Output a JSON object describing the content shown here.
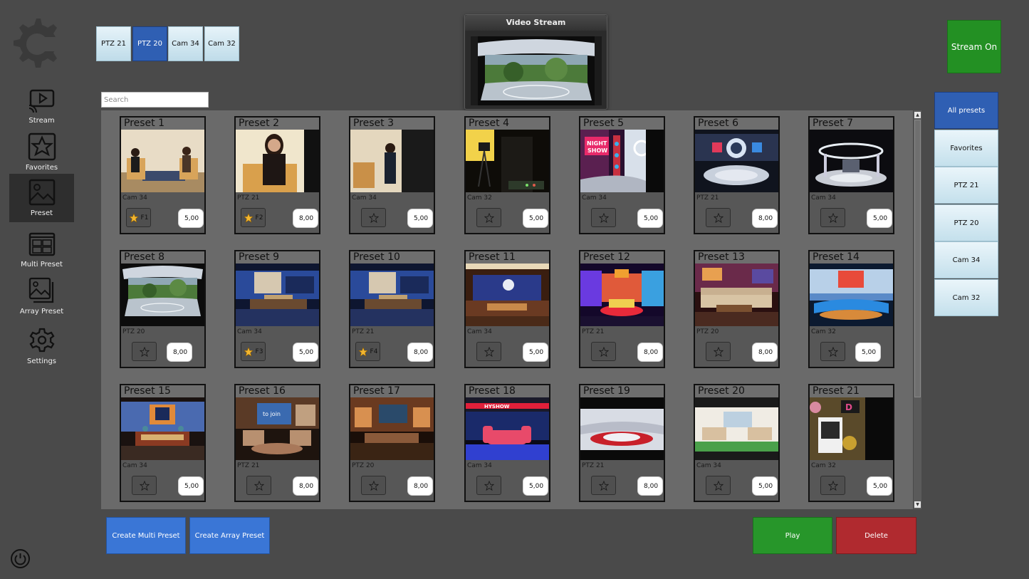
{
  "sidebar": {
    "items": [
      {
        "label": "Stream",
        "icon": "stream-icon"
      },
      {
        "label": "Favorites",
        "icon": "star-icon"
      },
      {
        "label": "Preset",
        "icon": "image-icon"
      },
      {
        "label": "Multi Preset",
        "icon": "multi-image-icon"
      },
      {
        "label": "Array Preset",
        "icon": "stacked-image-icon"
      },
      {
        "label": "Settings",
        "icon": "gear-icon"
      }
    ],
    "active": "Preset"
  },
  "camera_tabs": [
    {
      "label": "PTZ 21",
      "active": false
    },
    {
      "label": "PTZ 20",
      "active": true
    },
    {
      "label": "Cam 34",
      "active": false
    },
    {
      "label": "Cam 32",
      "active": false
    }
  ],
  "search": {
    "placeholder": "Search"
  },
  "video_stream": {
    "title": "Video Stream"
  },
  "stream_button": {
    "label": "Stream On"
  },
  "filters": [
    {
      "label": "All presets",
      "active": true
    },
    {
      "label": "Favorites",
      "active": false
    },
    {
      "label": "PTZ 21",
      "active": false
    },
    {
      "label": "PTZ 20",
      "active": false
    },
    {
      "label": "Cam 34",
      "active": false
    },
    {
      "label": "Cam 32",
      "active": false
    }
  ],
  "presets": [
    {
      "name": "Preset 1",
      "camera": "Cam 34",
      "fav_key": "F1",
      "duration": "5,00",
      "scene": "studio-two"
    },
    {
      "name": "Preset 2",
      "camera": "PTZ 21",
      "fav_key": "F2",
      "duration": "8,00",
      "scene": "studio-one"
    },
    {
      "name": "Preset 3",
      "camera": "Cam 34",
      "fav_key": "",
      "duration": "5,00",
      "scene": "studio-dark"
    },
    {
      "name": "Preset 4",
      "camera": "Cam 32",
      "fav_key": "",
      "duration": "5,00",
      "scene": "control-room"
    },
    {
      "name": "Preset 5",
      "camera": "Cam 34",
      "fav_key": "",
      "duration": "5,00",
      "scene": "night-show"
    },
    {
      "name": "Preset 6",
      "camera": "PTZ 21",
      "fav_key": "",
      "duration": "8,00",
      "scene": "round-stage"
    },
    {
      "name": "Preset 7",
      "camera": "Cam 34",
      "fav_key": "",
      "duration": "5,00",
      "scene": "ring-stage"
    },
    {
      "name": "Preset 8",
      "camera": "PTZ 20",
      "fav_key": "",
      "duration": "8,00",
      "scene": "garden-stage"
    },
    {
      "name": "Preset 9",
      "camera": "Cam 34",
      "fav_key": "F3",
      "duration": "5,00",
      "scene": "news-desk"
    },
    {
      "name": "Preset 10",
      "camera": "PTZ 21",
      "fav_key": "F4",
      "duration": "8,00",
      "scene": "news-desk"
    },
    {
      "name": "Preset 11",
      "camera": "Cam 34",
      "fav_key": "",
      "duration": "5,00",
      "scene": "blue-wall"
    },
    {
      "name": "Preset 12",
      "camera": "PTZ 21",
      "fav_key": "",
      "duration": "8,00",
      "scene": "colorful-stage"
    },
    {
      "name": "Preset 13",
      "camera": "PTZ 20",
      "fav_key": "",
      "duration": "8,00",
      "scene": "lounge-sofa"
    },
    {
      "name": "Preset 14",
      "camera": "Cam 32",
      "fav_key": "",
      "duration": "5,00",
      "scene": "blue-desk"
    },
    {
      "name": "Preset 15",
      "camera": "Cam 34",
      "fav_key": "",
      "duration": "5,00",
      "scene": "anchor-desk"
    },
    {
      "name": "Preset 16",
      "camera": "PTZ 21",
      "fav_key": "",
      "duration": "8,00",
      "scene": "talk-set"
    },
    {
      "name": "Preset 17",
      "camera": "PTZ 20",
      "fav_key": "",
      "duration": "8,00",
      "scene": "wood-set"
    },
    {
      "name": "Preset 18",
      "camera": "Cam 34",
      "fav_key": "",
      "duration": "5,00",
      "scene": "red-sofa"
    },
    {
      "name": "Preset 19",
      "camera": "PTZ 21",
      "fav_key": "",
      "duration": "8,00",
      "scene": "white-curve"
    },
    {
      "name": "Preset 20",
      "camera": "Cam 34",
      "fav_key": "",
      "duration": "5,00",
      "scene": "bright-living"
    },
    {
      "name": "Preset 21",
      "camera": "Cam 32",
      "fav_key": "",
      "duration": "5,00",
      "scene": "chair-corner"
    }
  ],
  "actions": {
    "create_multi": "Create Multi Preset",
    "create_array": "Create Array Preset",
    "play": "Play",
    "delete": "Delete"
  },
  "colors": {
    "background": "#4a4a4a",
    "accent_blue": "#2f5fb3",
    "play_green": "#27962a",
    "stream_green": "#239023",
    "delete_red": "#b02a2f",
    "favorite_star": "#f2b630"
  }
}
